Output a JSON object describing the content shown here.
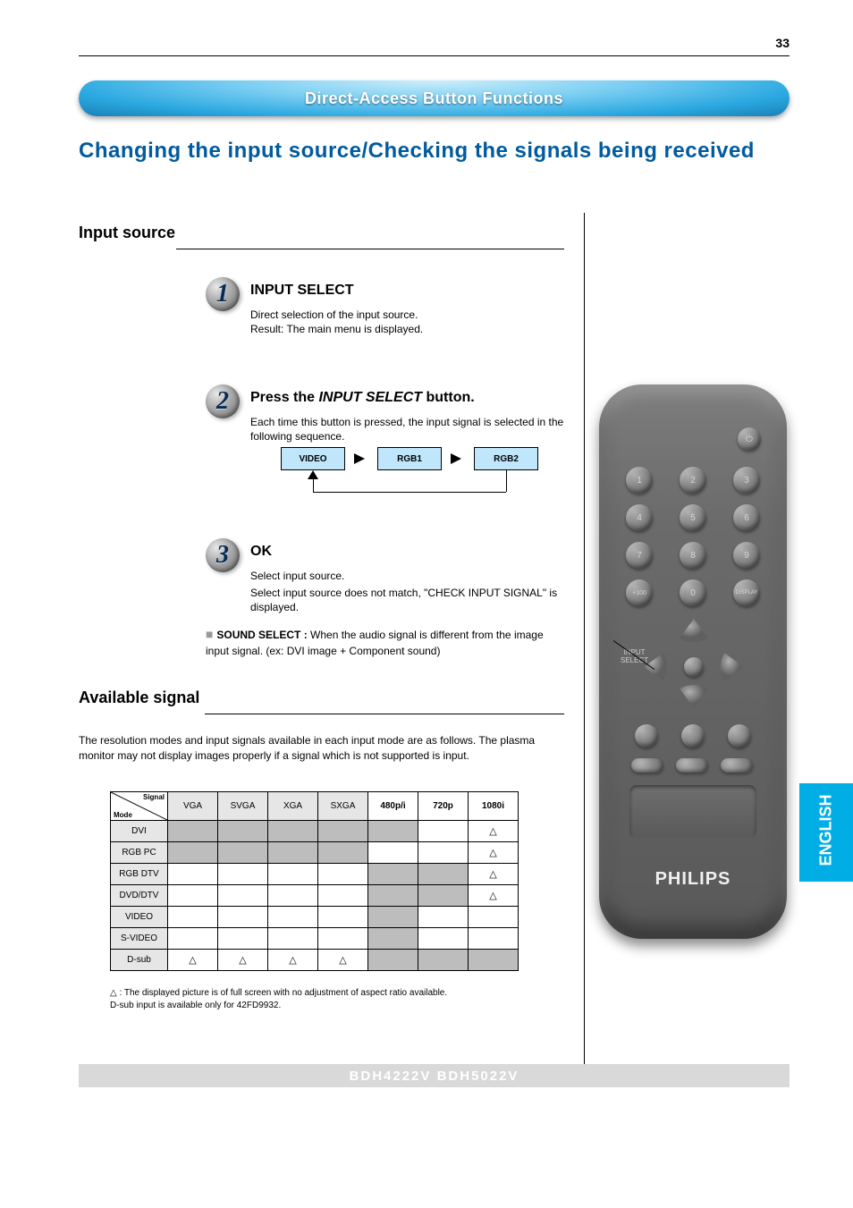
{
  "page_number": "33",
  "header": {
    "title_bar": "Direct-Access Button Functions",
    "subtitle": "Changing the input source/Checking the signals being received"
  },
  "section1": {
    "heading": "Input source",
    "step1": {
      "label": "INPUT SELECT",
      "body": "Direct selection of the input source.",
      "result": "Result: The main menu is displayed."
    },
    "step2": {
      "label_prefix": "Press the ",
      "label_em": "INPUT SELECT",
      "label_suffix": " button.",
      "body": "Each time this button is pressed, the input signal is selected in the following sequence.",
      "cycle": [
        "VIDEO",
        "RGB1",
        "RGB2"
      ]
    },
    "step3": {
      "label": "OK",
      "body1": "Select input source.",
      "body2": "Select input source does not match, \"CHECK INPUT SIGNAL\" is displayed."
    },
    "sound_note_bold": "SOUND SELECT : ",
    "sound_note_text": "When the audio signal is different from the image input signal. (ex: DVI image + Component sound)"
  },
  "section2": {
    "heading": "Available signal",
    "intro": "The resolution modes and input signals available in each input mode are as follows. The plasma monitor may not display images properly if a signal which is not supported is input.",
    "columns": [
      "VGA",
      "SVGA",
      "XGA",
      "SXGA",
      "480p/i",
      "720p",
      "1080i"
    ],
    "rows": [
      {
        "label": "DVI",
        "cells": [
          "grey",
          "grey",
          "grey",
          "grey",
          "grey",
          "white",
          "tri"
        ]
      },
      {
        "label": "RGB PC",
        "cells": [
          "grey",
          "grey",
          "grey",
          "grey",
          "white",
          "white",
          "tri"
        ]
      },
      {
        "label": "RGB DTV",
        "cells": [
          "white",
          "white",
          "white",
          "white",
          "grey",
          "grey",
          "tri"
        ]
      },
      {
        "label": "DVD/DTV",
        "cells": [
          "white",
          "white",
          "white",
          "white",
          "grey",
          "grey",
          "tri"
        ]
      },
      {
        "label": "VIDEO",
        "cells": [
          "white",
          "white",
          "white",
          "white",
          "grey",
          "white",
          "white"
        ]
      },
      {
        "label": "S-VIDEO",
        "cells": [
          "white",
          "white",
          "white",
          "white",
          "grey",
          "white",
          "white"
        ]
      },
      {
        "label": "D-sub",
        "cells": [
          "tri",
          "tri",
          "tri",
          "tri",
          "grey",
          "grey",
          "grey"
        ]
      }
    ],
    "diag_top": "Signal",
    "diag_bottom": "Mode",
    "note1": "△ : The displayed picture is of full screen with no adjustment of aspect ratio available.",
    "note2": "D-sub input is available only for 42FD9932."
  },
  "bottom_bar": "BDH4222V BDH5022V",
  "side_tab": "ENGLISH",
  "remote": {
    "brand": "PHILIPS",
    "buttons": {
      "power": "⏻",
      "digits": [
        "1",
        "2",
        "3",
        "4",
        "5",
        "6",
        "7",
        "8",
        "9",
        "+100",
        "0",
        "DISPLAY"
      ],
      "cursor_label": "INPUT\nSELECT",
      "pills": [
        "",
        "",
        ""
      ],
      "panel1": "",
      "panel2": ""
    }
  }
}
